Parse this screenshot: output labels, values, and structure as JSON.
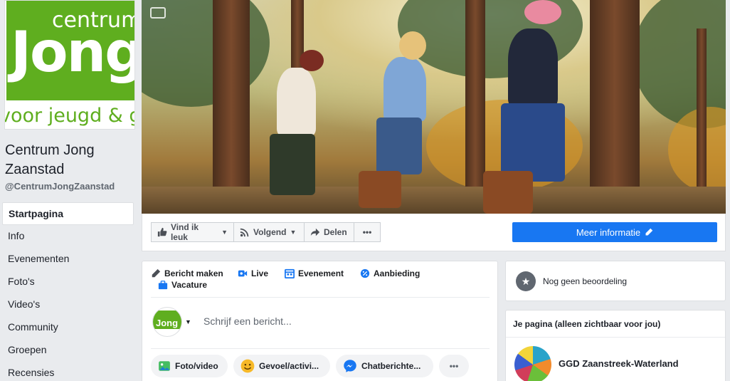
{
  "page": {
    "name": "Centrum Jong Zaanstad",
    "handle": "@CentrumJongZaanstad"
  },
  "logo": {
    "line1": "centrum",
    "line2": "Jong",
    "tagline": "voor jeugd & gezin",
    "color": "#5fae1f"
  },
  "nav": [
    {
      "label": "Startpagina",
      "active": true
    },
    {
      "label": "Info"
    },
    {
      "label": "Evenementen"
    },
    {
      "label": "Foto's"
    },
    {
      "label": "Video's"
    },
    {
      "label": "Community"
    },
    {
      "label": "Groepen"
    },
    {
      "label": "Recensies"
    }
  ],
  "actions": {
    "like": "Vind ik leuk",
    "follow": "Volgend",
    "share": "Delen",
    "more": "•••",
    "cta": "Meer informatie"
  },
  "composer": {
    "tabs": {
      "post": "Bericht maken",
      "live": "Live",
      "event": "Evenement",
      "offer": "Aanbieding",
      "job": "Vacature"
    },
    "placeholder": "Schrijf een bericht...",
    "pills": {
      "photo": "Foto/video",
      "feeling": "Gevoel/activi...",
      "chat": "Chatberichte...",
      "more": "•••"
    }
  },
  "rating": {
    "text": "Nog geen beoordeling"
  },
  "your_page": {
    "header": "Je pagina (alleen zichtbaar voor jou)",
    "linked_page": "GGD Zaanstreek-Waterland"
  },
  "colors": {
    "primary": "#1877f2",
    "brand_green": "#5fae1f"
  }
}
